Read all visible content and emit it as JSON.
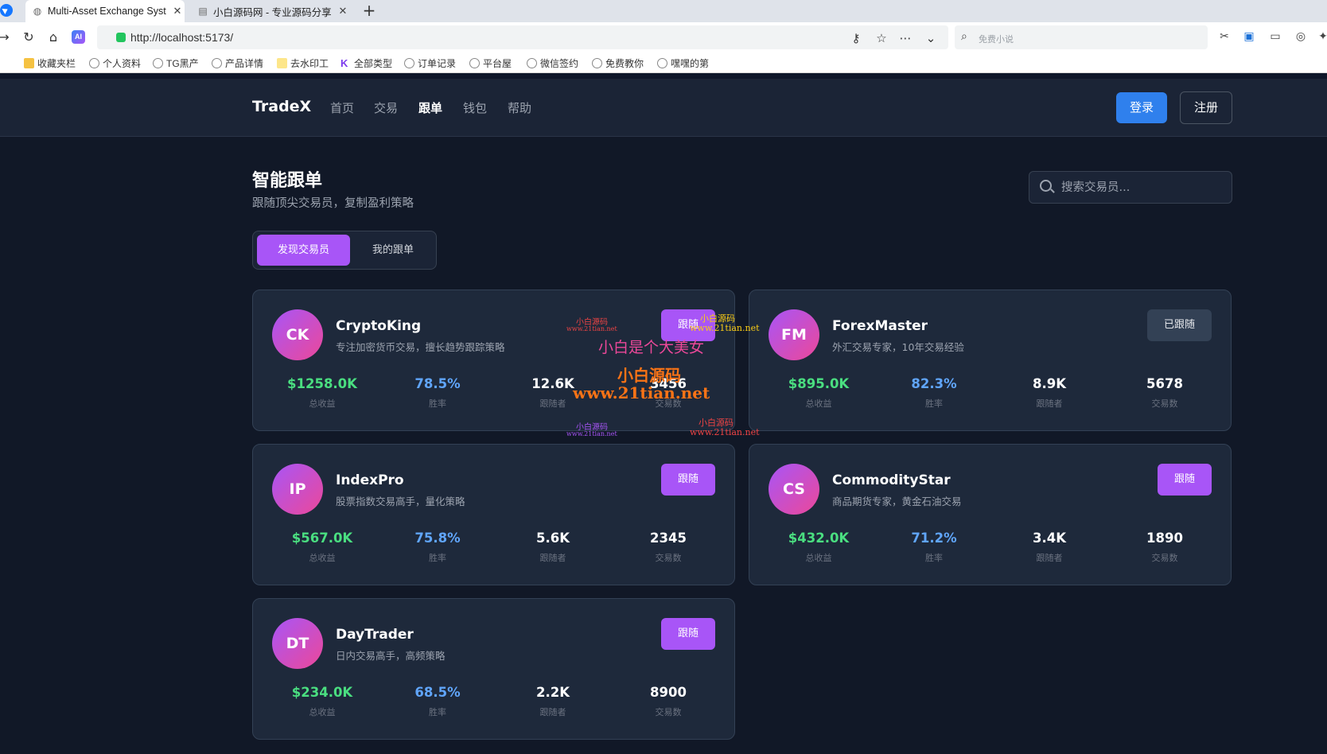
{
  "browser": {
    "tabs": [
      {
        "title": "Multi-Asset Exchange Syst",
        "active": true
      },
      {
        "title": "小白源码网 - 专业源码分享",
        "active": false
      }
    ],
    "url": "http://localhost:5173/",
    "search_placeholder": "免费小说",
    "bookmarks": [
      "收藏夹栏",
      "个人资料",
      "TG黑产",
      "产品详情",
      "去水印工",
      "全部类型",
      "订单记录",
      "平台屋",
      "微信签约",
      "免费教你",
      "嘿嘿的第"
    ]
  },
  "nav": {
    "brand": "TradeX",
    "links": [
      "首页",
      "交易",
      "跟单",
      "钱包",
      "帮助"
    ],
    "active_link": "跟单",
    "login": "登录",
    "register": "注册"
  },
  "page": {
    "title": "智能跟单",
    "subtitle": "跟随顶尖交易员，复制盈利策略",
    "search_placeholder": "搜索交易员...",
    "tabs": [
      "发现交易员",
      "我的跟单"
    ],
    "active_tab": "发现交易员"
  },
  "stat_labels": [
    "总收益",
    "胜率",
    "跟随者",
    "交易数"
  ],
  "traders": [
    {
      "initials": "CK",
      "name": "CryptoKing",
      "desc": "专注加密货币交易，擅长趋势跟踪策略",
      "profit": "$1258.0K",
      "win_rate": "78.5%",
      "followers": "12.6K",
      "trades": "3456",
      "action": "跟随",
      "followed": false
    },
    {
      "initials": "FM",
      "name": "ForexMaster",
      "desc": "外汇交易专家，10年交易经验",
      "profit": "$895.0K",
      "win_rate": "82.3%",
      "followers": "8.9K",
      "trades": "5678",
      "action": "已跟随",
      "followed": true
    },
    {
      "initials": "IP",
      "name": "IndexPro",
      "desc": "股票指数交易高手，量化策略",
      "profit": "$567.0K",
      "win_rate": "75.8%",
      "followers": "5.6K",
      "trades": "2345",
      "action": "跟随",
      "followed": false
    },
    {
      "initials": "CS",
      "name": "CommodityStar",
      "desc": "商品期货专家，黄金石油交易",
      "profit": "$432.0K",
      "win_rate": "71.2%",
      "followers": "3.4K",
      "trades": "1890",
      "action": "跟随",
      "followed": false
    },
    {
      "initials": "DT",
      "name": "DayTrader",
      "desc": "日内交易高手，高频策略",
      "profit": "$234.0K",
      "win_rate": "68.5%",
      "followers": "2.2K",
      "trades": "8900",
      "action": "跟随",
      "followed": false
    }
  ],
  "watermarks": {
    "main": "小白是个大美女",
    "brand": "小白源码",
    "site": "www.21tian.net",
    "site_alt": "www.21tian.net"
  },
  "colors": {
    "background": "#111827",
    "card": "#1e293b",
    "accent_purple": "#a855f7",
    "login_blue": "#2f80ed",
    "profit_green": "#4ade80",
    "winrate_blue": "#60a5fa"
  }
}
